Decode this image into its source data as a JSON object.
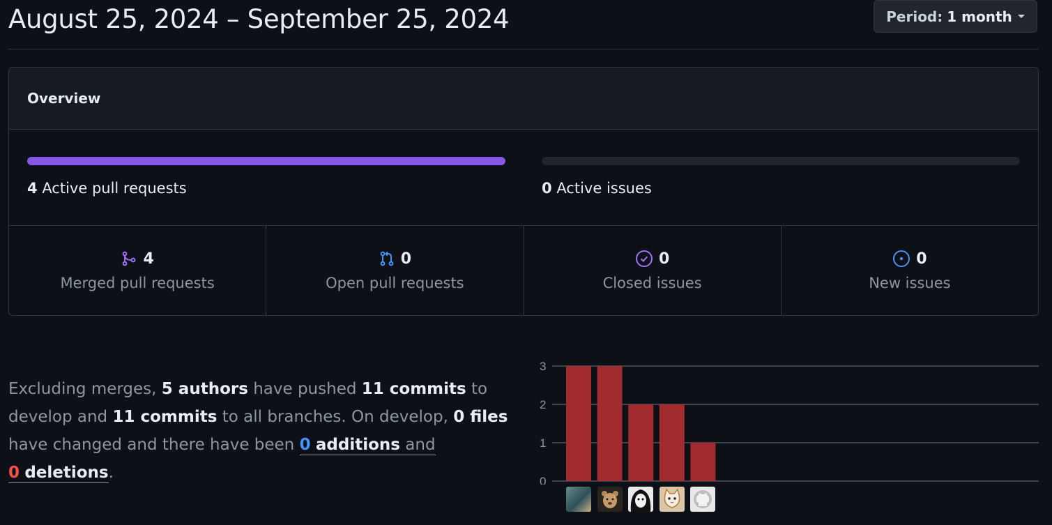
{
  "header": {
    "date_range": "August 25, 2024 – September 25, 2024",
    "period_prefix": "Period:",
    "period_value": "1 month"
  },
  "overview": {
    "title": "Overview",
    "active_prs": {
      "count": "4",
      "label": "Active pull requests",
      "fill_fraction": 1.0
    },
    "active_issues": {
      "count": "0",
      "label": "Active issues",
      "fill_fraction": 0.0
    },
    "stats": [
      {
        "count": "4",
        "label": "Merged pull requests",
        "icon": "merge-icon",
        "color": "#a371f7"
      },
      {
        "count": "0",
        "label": "Open pull requests",
        "icon": "pull-request-icon",
        "color": "#4493f8"
      },
      {
        "count": "0",
        "label": "Closed issues",
        "icon": "issue-closed-icon",
        "color": "#a371f7"
      },
      {
        "count": "0",
        "label": "New issues",
        "icon": "issue-opened-icon",
        "color": "#4493f8"
      }
    ]
  },
  "summary": {
    "t1": "Excluding merges, ",
    "authors": "5 authors",
    "t2": " have pushed ",
    "commits1": "11 commits",
    "t3": " to develop and ",
    "commits2": "11 commits",
    "t4": " to all branches. On develop, ",
    "files": "0 files",
    "t5": " have changed and there have been ",
    "add_num": "0",
    "add_word": "additions",
    "t6": " and",
    "del_num": "0",
    "del_word": "deletions",
    "t7": "."
  },
  "chart_data": {
    "type": "bar",
    "categories": [
      "author-1",
      "author-2",
      "author-3",
      "author-4",
      "author-5"
    ],
    "values": [
      3,
      3,
      2,
      2,
      1
    ],
    "ylim": [
      0,
      3
    ],
    "yticks": [
      "0",
      "1",
      "2",
      "3"
    ],
    "bar_color": "#a12b2e",
    "grid": true
  },
  "colors": {
    "accent_purple": "#8957e5",
    "link_blue": "#4493f8",
    "danger_red": "#f85149"
  }
}
